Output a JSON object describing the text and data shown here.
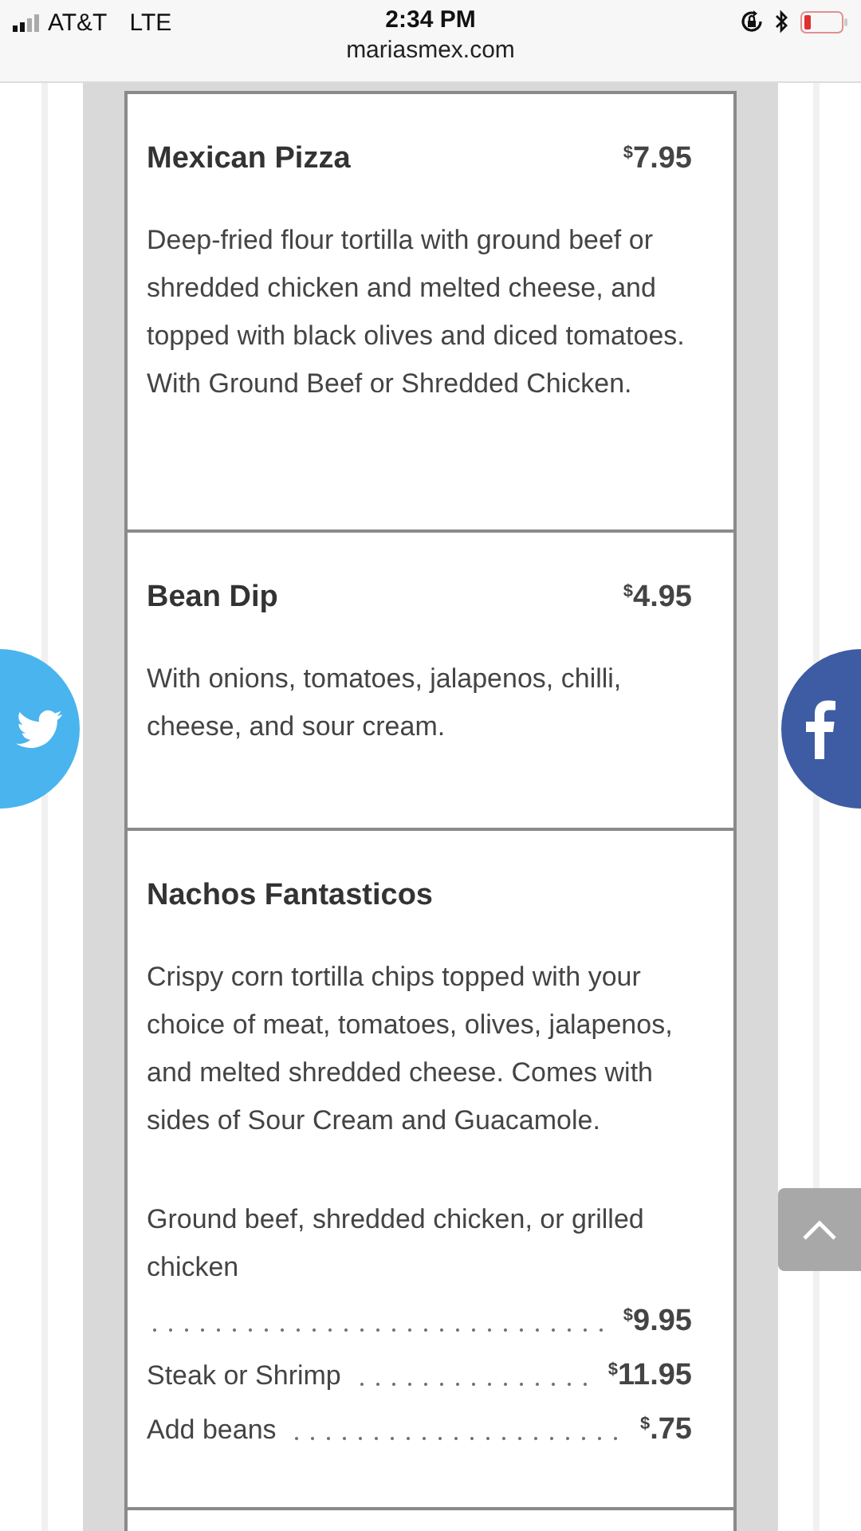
{
  "status_bar": {
    "carrier": "AT&T",
    "network": "LTE",
    "time": "2:34 PM",
    "url": "mariasmex.com"
  },
  "menu_items": [
    {
      "name": "Mexican Pizza",
      "price": {
        "currency": "$",
        "amount": "7.95"
      },
      "description": "Deep-fried flour tortilla with ground beef or shredded chicken and melted cheese, and topped with black olives and diced tomatoes. With Ground Beef or Shredded Chicken."
    },
    {
      "name": "Bean Dip",
      "price": {
        "currency": "$",
        "amount": "4.95"
      },
      "description": "With onions, tomatoes, jalapenos, chilli, cheese, and sour cream."
    },
    {
      "name": "Nachos Fantasticos",
      "description": "Crispy corn tortilla chips topped with your choice of meat, tomatoes, olives, jalapenos, and melted shredded cheese. Comes with sides of Sour Cream and Guacamole.",
      "options": [
        {
          "label": "Ground beef, shredded chicken, or grilled chicken",
          "price": {
            "currency": "$",
            "amount": "9.95"
          }
        },
        {
          "label": "Steak or Shrimp",
          "price": {
            "currency": "$",
            "amount": "11.95"
          }
        },
        {
          "label": "Add beans",
          "price": {
            "currency": "$",
            "amount": ".75"
          }
        }
      ]
    }
  ]
}
